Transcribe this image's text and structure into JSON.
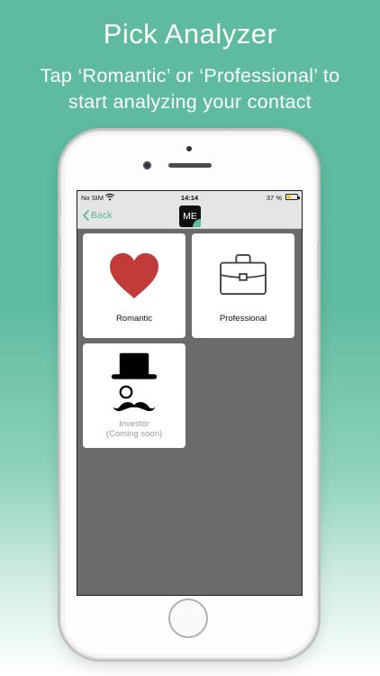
{
  "promo": {
    "headline": "Pick Analyzer",
    "subline": "Tap ‘Romantic’ or ‘Professional’ to start analyzing your contact"
  },
  "statusbar": {
    "carrier": "No SIM",
    "time": "14:14",
    "battery": "37 %",
    "battery_level": 0.37
  },
  "navbar": {
    "back_label": "Back",
    "logo_text": "ME"
  },
  "tiles": [
    {
      "label": "Romantic",
      "icon": "heart-icon",
      "color": "#c23b3b"
    },
    {
      "label": "Professional",
      "icon": "briefcase-icon"
    },
    {
      "label": "Investor",
      "sublabel": "(Coming soon)",
      "icon": "top-hat-monocle-mustache-icon"
    }
  ],
  "colors": {
    "accent": "#4bb998",
    "background_teal": "#5ebb9f",
    "screen_bg": "#6b6b6b"
  }
}
